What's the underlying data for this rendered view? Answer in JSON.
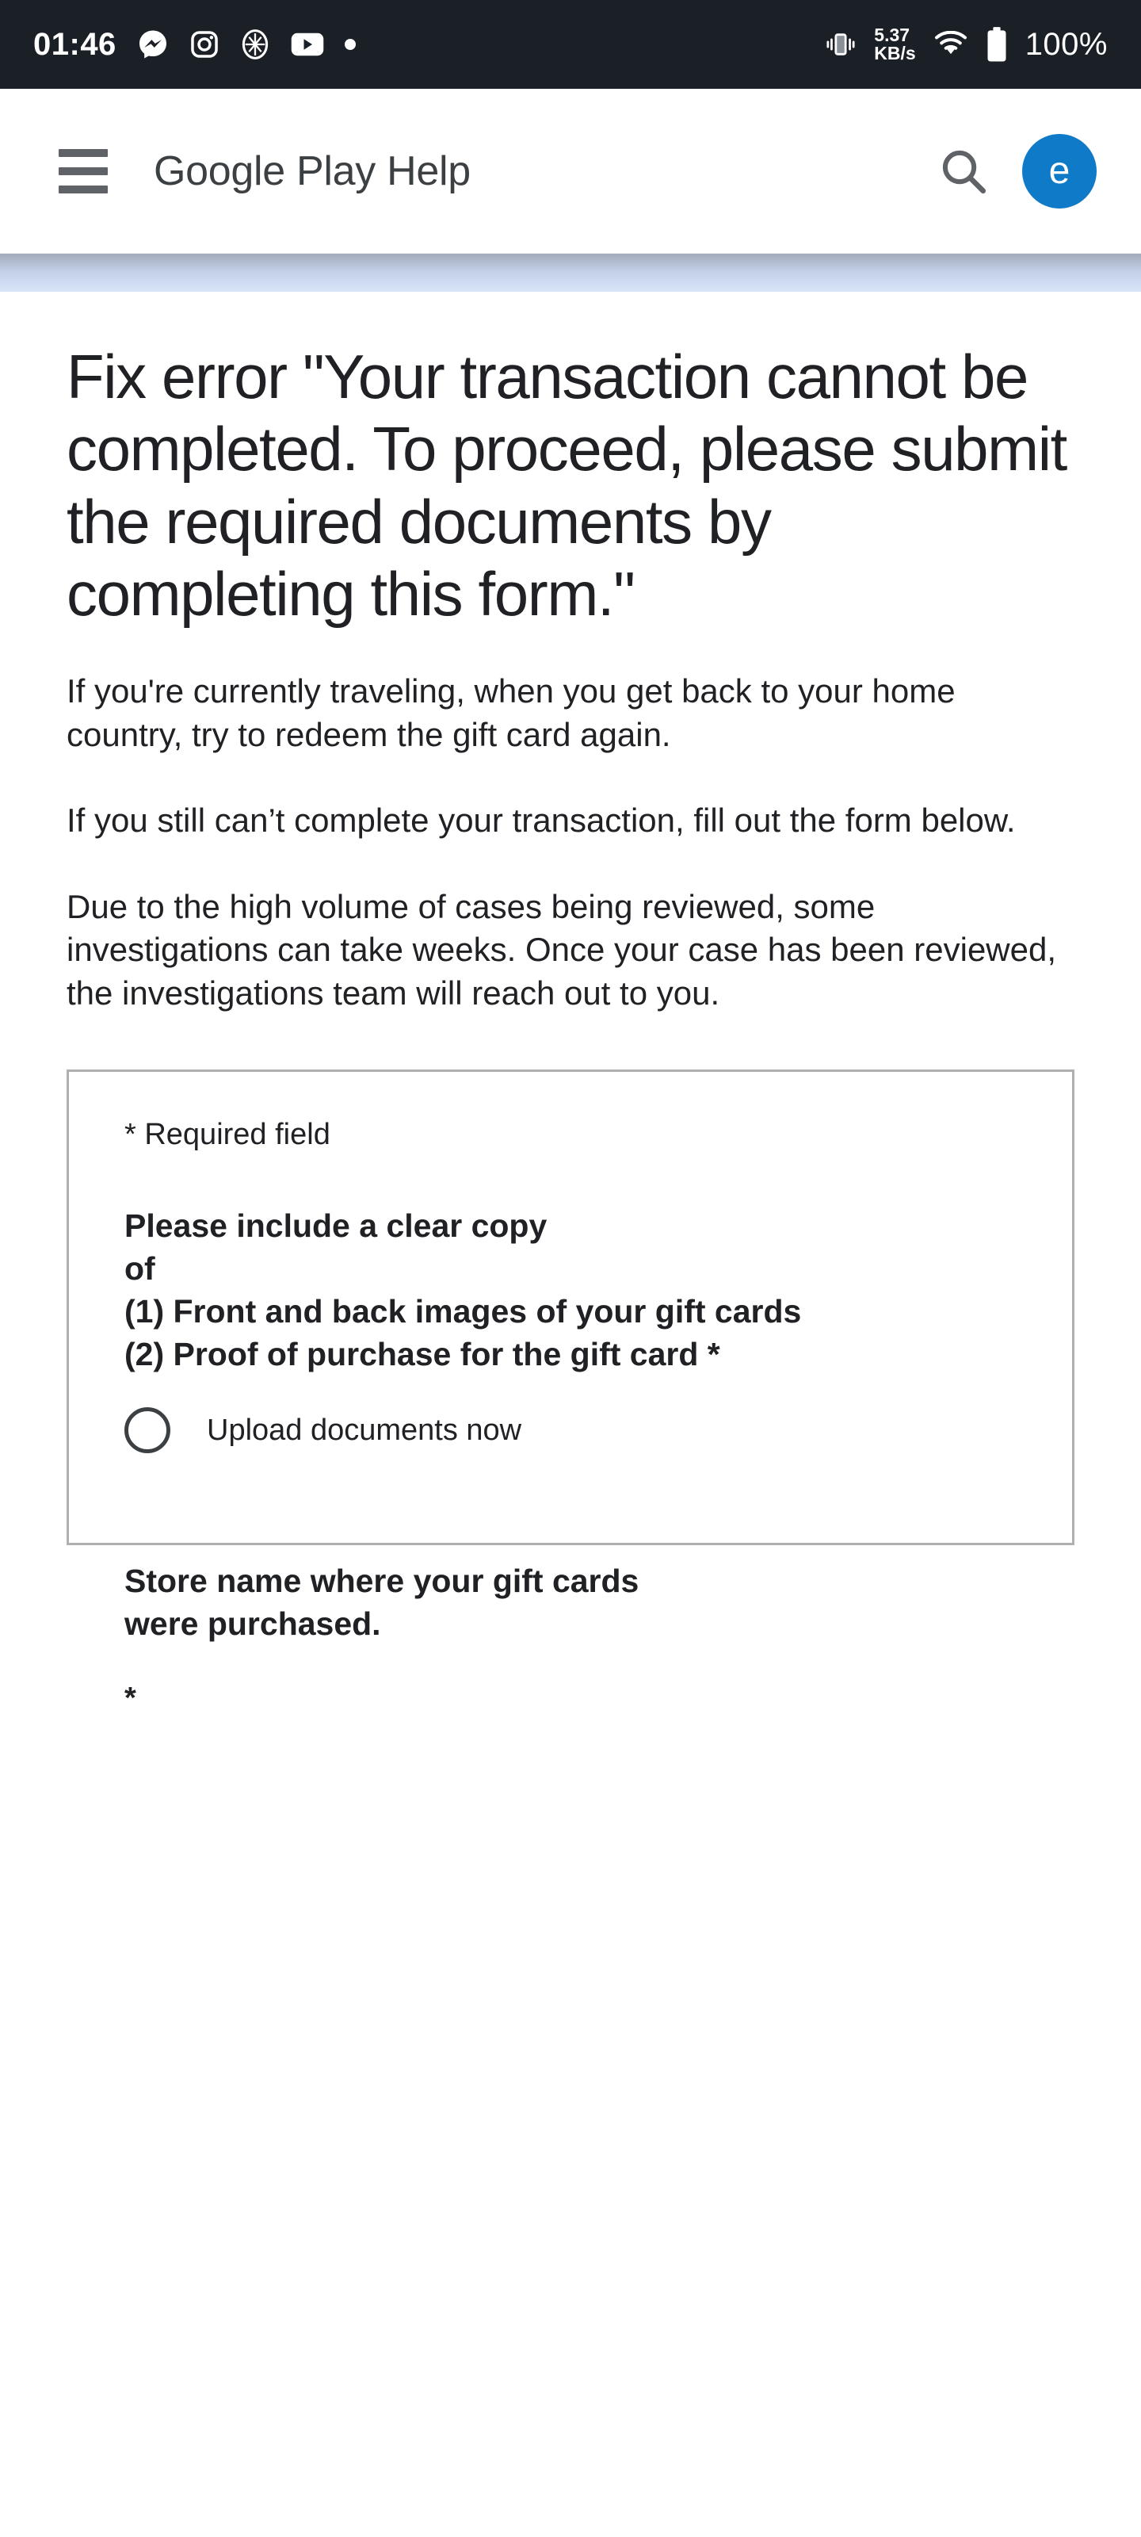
{
  "status_bar": {
    "clock": "01:46",
    "network_speed_value": "5.37",
    "network_speed_unit": "KB/s",
    "battery_percent": "100%",
    "icons": [
      "messenger-icon",
      "instagram-icon",
      "shield-icon",
      "youtube-icon",
      "dot-indicator-icon",
      "vibrate-icon",
      "wifi-icon",
      "battery-icon"
    ]
  },
  "header": {
    "menu_icon": "hamburger-menu-icon",
    "title": "Google Play Help",
    "search_icon": "search-icon",
    "avatar_initial": "e",
    "avatar_color": "#0f7ac7"
  },
  "article": {
    "title": "Fix error \"Your transaction cannot be completed. To proceed, please submit the required documents by completing this form.\"",
    "paragraphs": [
      "If you're currently traveling, when you get back to your home country, try to redeem the gift card again.",
      "If you still can’t complete your transaction, fill out the form below.",
      "Due to the high volume of cases being reviewed, some investigations can take weeks. Once your case has been reviewed, the investigations team will reach out to you."
    ]
  },
  "form": {
    "required_note": "* Required field",
    "question_1_lines": [
      "Please include a clear copy",
      "of",
      "(1) Front and back images of your gift cards",
      "(2) Proof of purchase for the gift card *"
    ],
    "radio_option_label": "Upload documents now",
    "radio_selected": false,
    "question_2_lines": [
      "Store name where your gift cards",
      "were purchased."
    ],
    "question_2_required_marker": "*"
  }
}
